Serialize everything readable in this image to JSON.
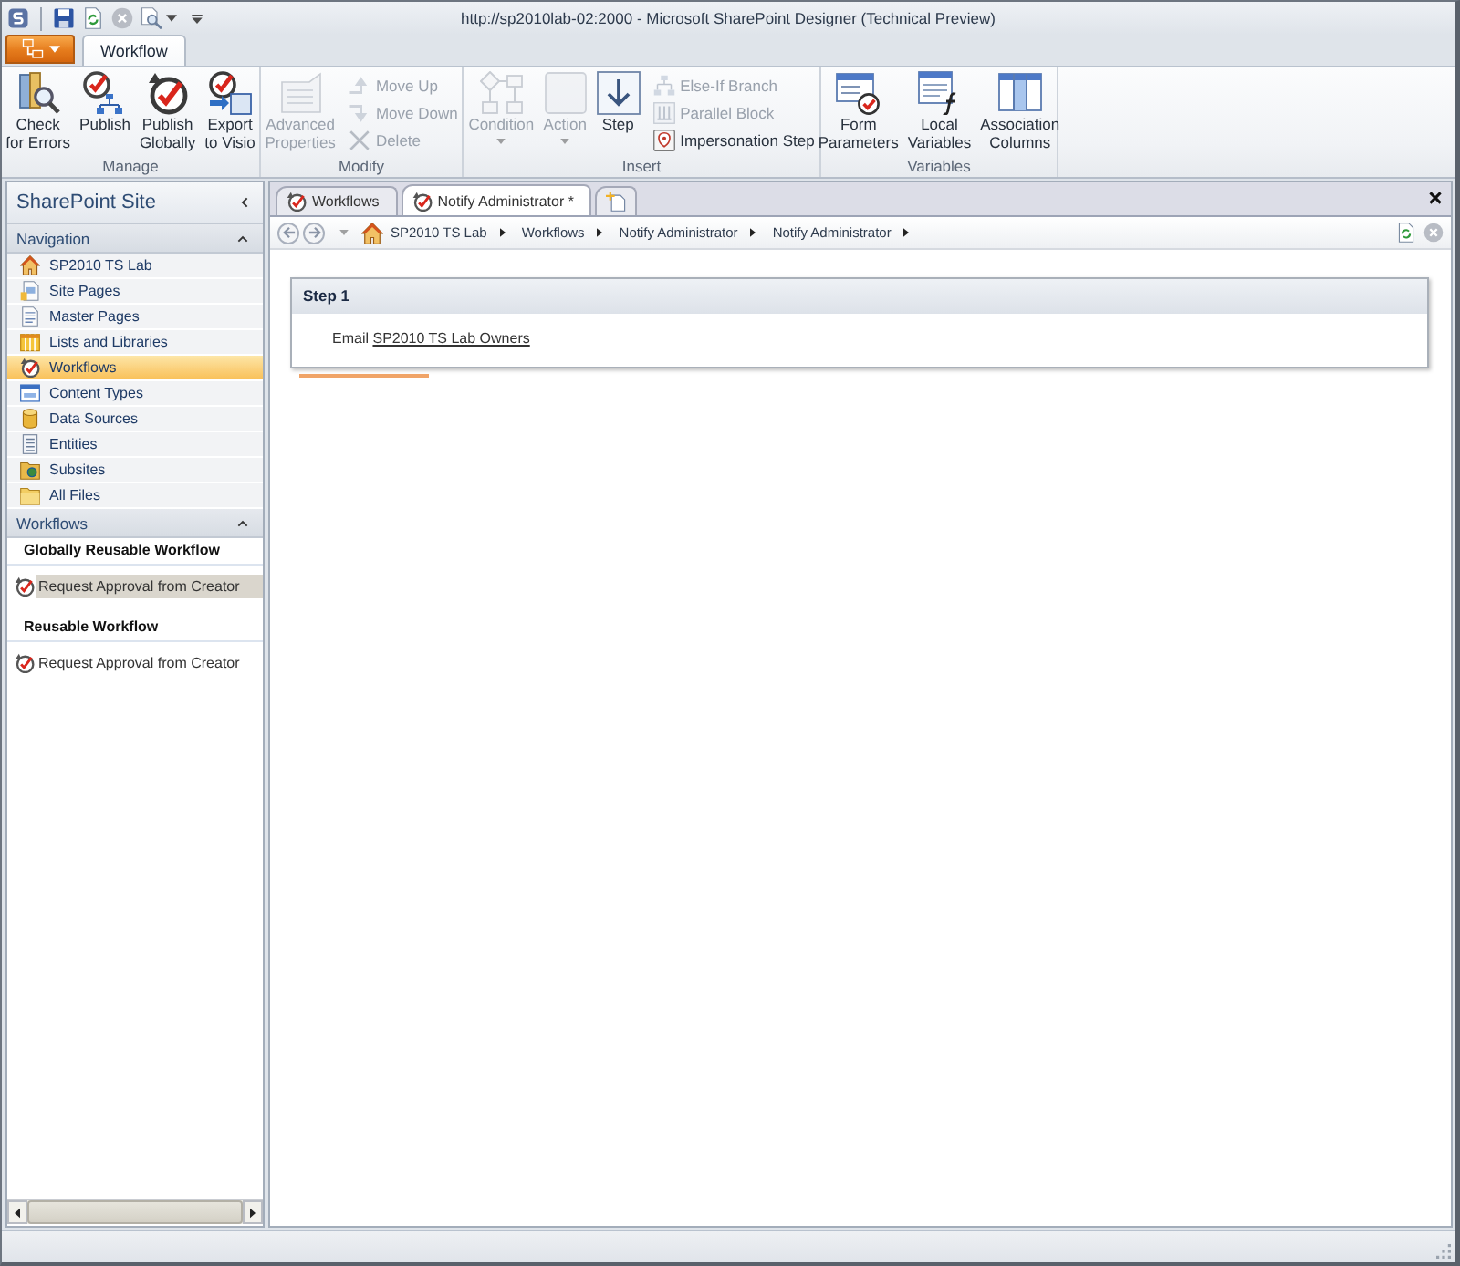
{
  "window": {
    "title": "http://sp2010lab-02:2000 - Microsoft SharePoint Designer (Technical Preview)"
  },
  "ribbon": {
    "tabs": [
      {
        "label": "Workflow",
        "selected": true
      }
    ],
    "groups": [
      {
        "label": "Manage",
        "buttons": [
          {
            "kind": "large",
            "lines": [
              "Check",
              "for Errors"
            ],
            "disabled": false,
            "dropdown": false
          },
          {
            "kind": "large",
            "lines": [
              "Publish"
            ],
            "disabled": false,
            "dropdown": false
          },
          {
            "kind": "large",
            "lines": [
              "Publish",
              "Globally"
            ],
            "disabled": false,
            "dropdown": false
          },
          {
            "kind": "large",
            "lines": [
              "Export",
              "to Visio"
            ],
            "disabled": false,
            "dropdown": false
          }
        ]
      },
      {
        "label": "Modify",
        "buttons": [
          {
            "kind": "large",
            "lines": [
              "Advanced",
              "Properties"
            ],
            "disabled": true,
            "dropdown": false
          },
          {
            "kind": "small",
            "lines": [
              "Move Up"
            ],
            "disabled": true,
            "dropdown": false
          },
          {
            "kind": "small",
            "lines": [
              "Move Down"
            ],
            "disabled": true,
            "dropdown": false
          },
          {
            "kind": "small",
            "lines": [
              "Delete"
            ],
            "disabled": true,
            "dropdown": false
          }
        ]
      },
      {
        "label": "Insert",
        "buttons": [
          {
            "kind": "large",
            "lines": [
              "Condition"
            ],
            "disabled": true,
            "dropdown": true
          },
          {
            "kind": "large",
            "lines": [
              "Action"
            ],
            "disabled": true,
            "dropdown": true
          },
          {
            "kind": "large",
            "lines": [
              "Step"
            ],
            "disabled": false,
            "dropdown": false
          },
          {
            "kind": "small",
            "lines": [
              "Else-If Branch"
            ],
            "disabled": true,
            "dropdown": false
          },
          {
            "kind": "small",
            "lines": [
              "Parallel Block"
            ],
            "disabled": true,
            "dropdown": false
          },
          {
            "kind": "small",
            "lines": [
              "Impersonation Step"
            ],
            "disabled": false,
            "dropdown": false
          }
        ]
      },
      {
        "label": "Variables",
        "buttons": [
          {
            "kind": "large",
            "lines": [
              "Form",
              "Parameters"
            ],
            "disabled": false,
            "dropdown": false
          },
          {
            "kind": "large",
            "lines": [
              "Local",
              "Variables"
            ],
            "disabled": false,
            "dropdown": false
          },
          {
            "kind": "large",
            "lines": [
              "Association",
              "Columns"
            ],
            "disabled": false,
            "dropdown": false
          }
        ]
      }
    ]
  },
  "site_panel": {
    "title": "SharePoint Site",
    "navigation": {
      "title": "Navigation",
      "expanded": true,
      "items": [
        {
          "label": "SP2010 TS Lab",
          "selected": false
        },
        {
          "label": "Site Pages",
          "selected": false
        },
        {
          "label": "Master Pages",
          "selected": false
        },
        {
          "label": "Lists and Libraries",
          "selected": false
        },
        {
          "label": "Workflows",
          "selected": true
        },
        {
          "label": "Content Types",
          "selected": false
        },
        {
          "label": "Data Sources",
          "selected": false
        },
        {
          "label": "Entities",
          "selected": false
        },
        {
          "label": "Subsites",
          "selected": false
        },
        {
          "label": "All Files",
          "selected": false
        }
      ]
    },
    "workflows": {
      "title": "Workflows",
      "expanded": true,
      "groups": [
        {
          "title": "Globally Reusable Workflow",
          "items": [
            {
              "label": "Request Approval from Creator",
              "selected": true
            }
          ]
        },
        {
          "title": "Reusable Workflow",
          "items": [
            {
              "label": "Request Approval from Creator",
              "selected": false
            }
          ]
        }
      ]
    }
  },
  "document_tabs": [
    {
      "label": "Workflows",
      "selected": false
    },
    {
      "label": "Notify Administrator *",
      "selected": true
    }
  ],
  "breadcrumb": [
    "SP2010 TS Lab",
    "Workflows",
    "Notify Administrator",
    "Notify Administrator"
  ],
  "steps": [
    {
      "title": "Step 1",
      "actions": [
        {
          "verb": "Email",
          "link": "SP2010 TS Lab Owners"
        }
      ]
    }
  ]
}
